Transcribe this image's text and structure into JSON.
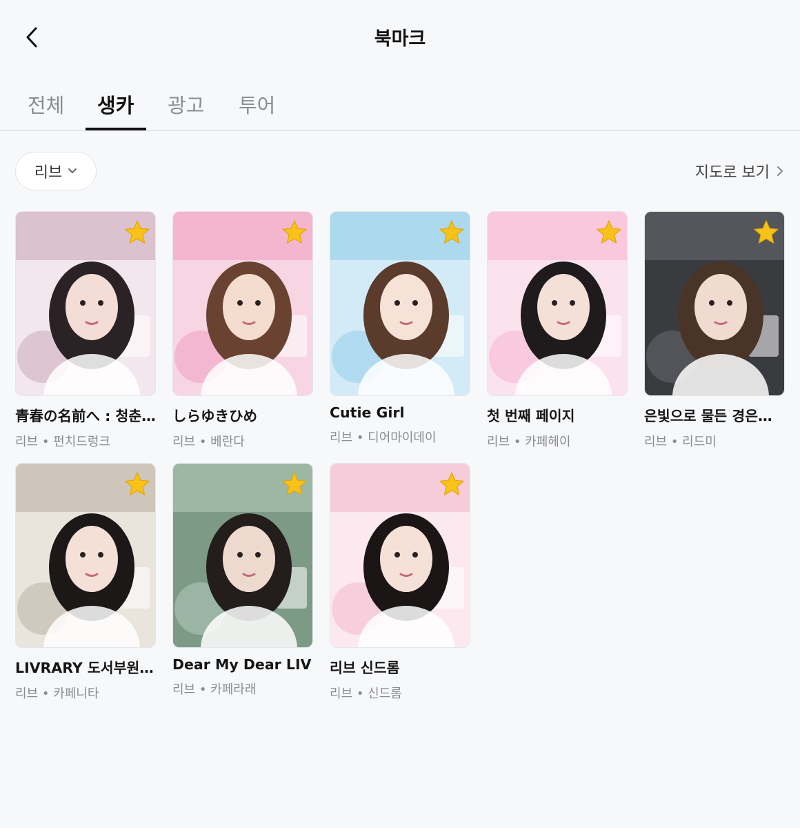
{
  "header": {
    "title": "북마크"
  },
  "tabs": [
    {
      "label": "전체",
      "active": false
    },
    {
      "label": "생카",
      "active": true
    },
    {
      "label": "광고",
      "active": false
    },
    {
      "label": "투어",
      "active": false
    }
  ],
  "filter": {
    "selected": "리브"
  },
  "map_link": {
    "label": "지도로 보기"
  },
  "colors": {
    "accent": "#111111",
    "star": "#f8c21a",
    "muted": "#8a8b90"
  },
  "cards": [
    {
      "title": "青春の名前へ : 청춘의 이름에게",
      "subtitle": "리브 • 펀치드렁크",
      "bookmarked": true,
      "thumb_bg": "#f3e7ee",
      "thumb_fg": "#c9a3b6",
      "hair": "#2b2226",
      "skin": "#f3ddd6"
    },
    {
      "title": "しらゆきひめ",
      "subtitle": "리브 • 베란다",
      "bookmarked": true,
      "thumb_bg": "#f7d5e3",
      "thumb_fg": "#f29ac0",
      "hair": "#6a4232",
      "skin": "#f4dccf"
    },
    {
      "title": "Cutie Girl",
      "subtitle": "리브 • 디어마이데이",
      "bookmarked": true,
      "thumb_bg": "#d3ebf7",
      "thumb_fg": "#8ecbea",
      "hair": "#5a3b2c",
      "skin": "#f6e2d6"
    },
    {
      "title": "첫 번째 페이지",
      "subtitle": "리브 • 카페헤이",
      "bookmarked": true,
      "thumb_bg": "#fbe3ee",
      "thumb_fg": "#f7b2cf",
      "hair": "#1f1a1c",
      "skin": "#f5e0d8"
    },
    {
      "title": "은빛으로 물든 경은의 하루",
      "subtitle": "리브 • 리드미",
      "bookmarked": true,
      "thumb_bg": "#3a3b3f",
      "thumb_fg": "#6a6d74",
      "hair": "#4a3428",
      "skin": "#f1dad0"
    },
    {
      "title": "LIVRARY 도서부원 모집",
      "subtitle": "리브 • 카페니타",
      "bookmarked": true,
      "thumb_bg": "#e9e4dc",
      "thumb_fg": "#b8ada0",
      "hair": "#1c1818",
      "skin": "#f4e0d6"
    },
    {
      "title": "Dear My Dear LIV",
      "subtitle": "리브 • 카페라래",
      "bookmarked": true,
      "thumb_bg": "#7d9a86",
      "thumb_fg": "#b8cfc0",
      "hair": "#231d1c",
      "skin": "#eed9cf"
    },
    {
      "title": "리브 신드롬",
      "subtitle": "리브 • 신드롬",
      "bookmarked": true,
      "thumb_bg": "#fbe9ef",
      "thumb_fg": "#f4b5c9",
      "hair": "#1b1516",
      "skin": "#f6e1d9"
    }
  ]
}
